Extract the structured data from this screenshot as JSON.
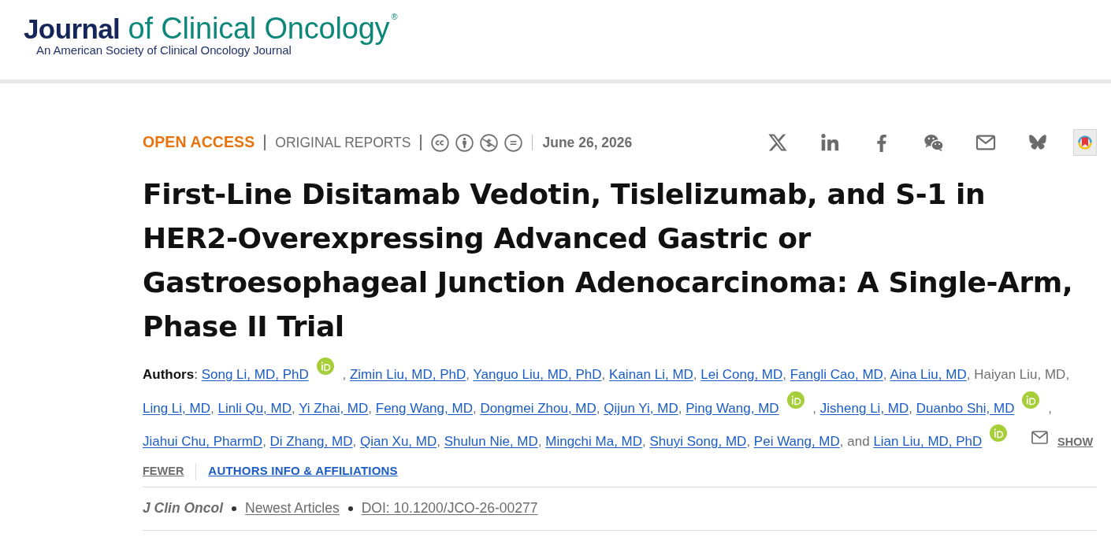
{
  "header": {
    "logo": "**Journal** of Clinical Oncology$^{®}$",
    "tagline": "An American Society of Clinical Oncology Journal"
  },
  "article_meta": {
    "access": "OPEN ACCESS",
    "section": "ORIGINAL REPORTS",
    "date": "June 26, 2026"
  },
  "title": "First-Line Disitamab Vedotin, Tislelizumab, and S-1 in HER2-Overexpressing Advanced Gastric or Gastroesophageal Junction Adenocarcinoma: A Single-Arm, Phase II Trial",
  "authors": {
    "label": "**Authors**:",
    "separator": ",",
    "conjunction": "and",
    "list": [
      {
        "name": "Song Li, MD, PhD",
        "linked": true,
        "orcid": true,
        "email": false
      },
      {
        "name": "Zimin Liu, MD, PhD",
        "linked": true,
        "orcid": false,
        "email": false
      },
      {
        "name": "Yanguo Liu, MD, PhD",
        "linked": true,
        "orcid": false,
        "email": false
      },
      {
        "name": "Kainan Li, MD",
        "linked": true,
        "orcid": false,
        "email": false
      },
      {
        "name": "Lei Cong, MD",
        "linked": true,
        "orcid": false,
        "email": false
      },
      {
        "name": "Fangli Cao, MD",
        "linked": true,
        "orcid": false,
        "email": false
      },
      {
        "name": "Aina Liu, MD",
        "linked": true,
        "orcid": false,
        "email": false
      },
      {
        "name": "Haiyan Liu, MD",
        "linked": false,
        "orcid": false,
        "email": false
      },
      {
        "name": "Ling Li, MD",
        "linked": true,
        "orcid": false,
        "email": false
      },
      {
        "name": "Linli Qu, MD",
        "linked": true,
        "orcid": false,
        "email": false
      },
      {
        "name": "Yi Zhai, MD",
        "linked": true,
        "orcid": false,
        "email": false
      },
      {
        "name": "Feng Wang, MD",
        "linked": true,
        "orcid": false,
        "email": false
      },
      {
        "name": "Dongmei Zhou, MD",
        "linked": true,
        "orcid": false,
        "email": false
      },
      {
        "name": "Qijun Yi, MD",
        "linked": true,
        "orcid": false,
        "email": false
      },
      {
        "name": "Ping Wang, MD",
        "linked": true,
        "orcid": true,
        "email": false
      },
      {
        "name": "Jisheng Li, MD",
        "linked": true,
        "orcid": false,
        "email": false
      },
      {
        "name": "Duanbo Shi, MD",
        "linked": true,
        "orcid": true,
        "email": false
      },
      {
        "name": "Jiahui Chu, PharmD",
        "linked": true,
        "orcid": false,
        "email": false
      },
      {
        "name": "Di Zhang, MD",
        "linked": true,
        "orcid": false,
        "email": false
      },
      {
        "name": "Qian Xu, MD",
        "linked": true,
        "orcid": false,
        "email": false
      },
      {
        "name": "Shulun Nie, MD",
        "linked": true,
        "orcid": false,
        "email": false
      },
      {
        "name": "Mingchi Ma, MD",
        "linked": true,
        "orcid": false,
        "email": false
      },
      {
        "name": "Shuyi Song, MD",
        "linked": true,
        "orcid": false,
        "email": false
      },
      {
        "name": "Pei Wang, MD",
        "linked": true,
        "orcid": false,
        "email": false
      },
      {
        "name": "Lian Liu, MD, PhD",
        "linked": true,
        "orcid": true,
        "email": true
      }
    ]
  },
  "author_actions": {
    "show_fewer": [
      "SHOW",
      "FEWER"
    ],
    "info_link": "AUTHORS INFO & AFFILIATIONS"
  },
  "citation": {
    "journal": "J Clin Oncol",
    "section_link": "Newest Articles",
    "doi_link": "DOI: 10.1200/JCO-26-00277"
  }
}
